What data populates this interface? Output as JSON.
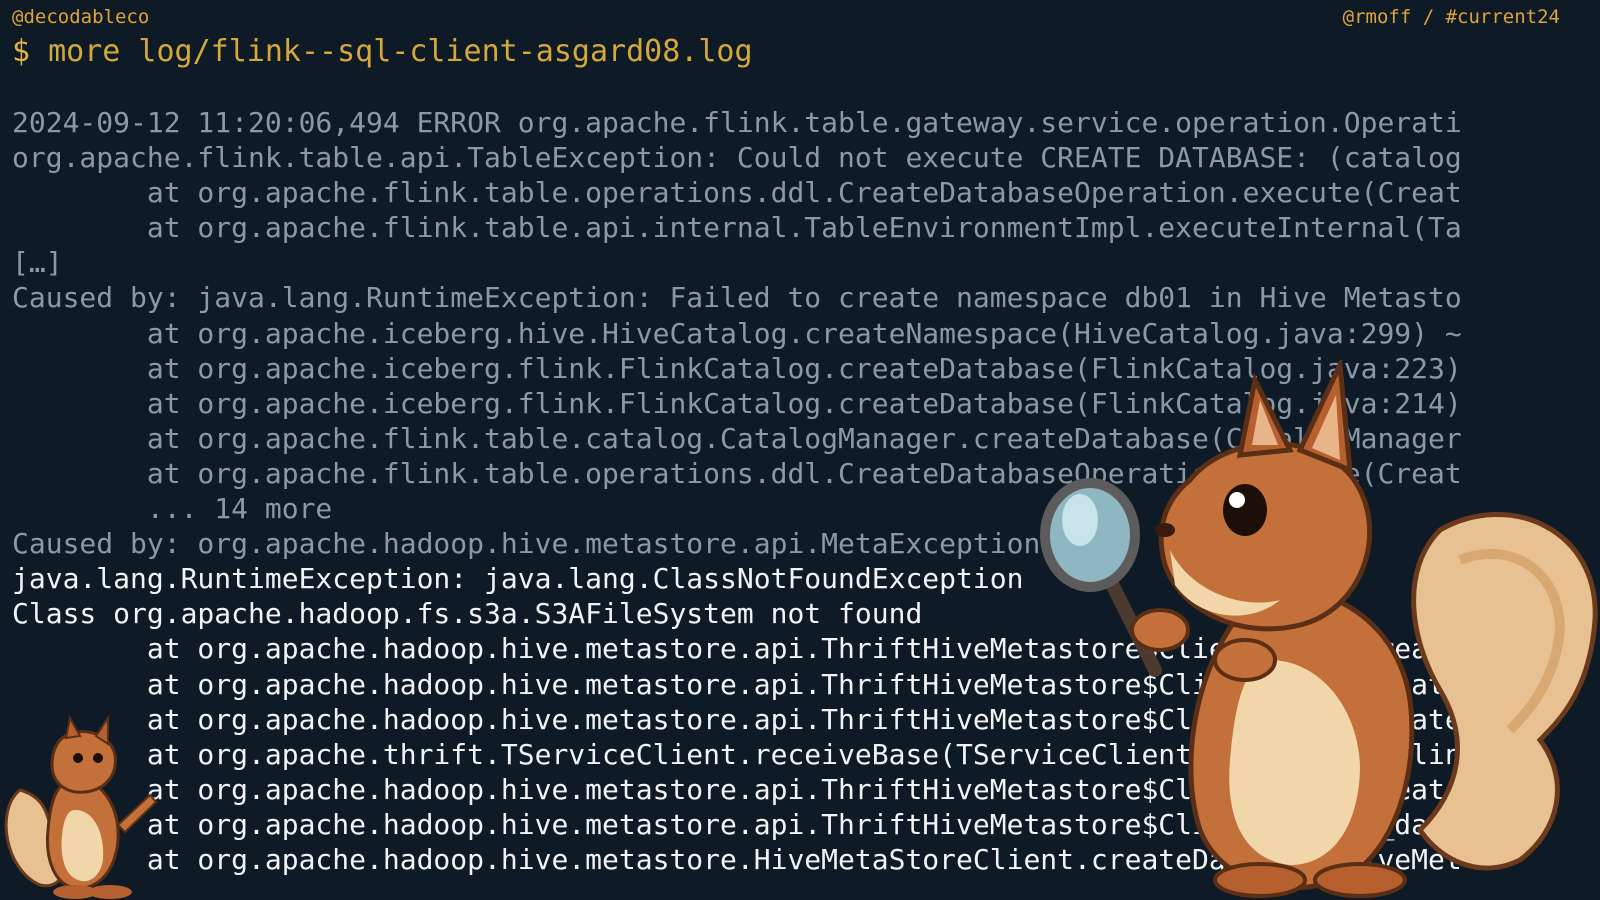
{
  "header": {
    "left_handle": "@decodableco",
    "right_handle": "@rmoff / #current24"
  },
  "terminal": {
    "prompt_symbol": "$",
    "command": "more log/flink--sql-client-asgard08.log"
  },
  "log": {
    "lines": [
      {
        "text": "2024-09-12 11:20:06,494 ERROR org.apache.flink.table.gateway.service.operation.Operati",
        "bright": false
      },
      {
        "text": "org.apache.flink.table.api.TableException: Could not execute CREATE DATABASE: (catalog",
        "bright": false
      },
      {
        "text": "        at org.apache.flink.table.operations.ddl.CreateDatabaseOperation.execute(Creat",
        "bright": false
      },
      {
        "text": "        at org.apache.flink.table.api.internal.TableEnvironmentImpl.executeInternal(Ta",
        "bright": false
      },
      {
        "text": "[…]",
        "bright": false
      },
      {
        "text": "Caused by: java.lang.RuntimeException: Failed to create namespace db01 in Hive Metasto",
        "bright": false
      },
      {
        "text": "        at org.apache.iceberg.hive.HiveCatalog.createNamespace(HiveCatalog.java:299) ~",
        "bright": false
      },
      {
        "text": "        at org.apache.iceberg.flink.FlinkCatalog.createDatabase(FlinkCatalog.java:223)",
        "bright": false
      },
      {
        "text": "        at org.apache.iceberg.flink.FlinkCatalog.createDatabase(FlinkCatalog.java:214)",
        "bright": false
      },
      {
        "text": "        at org.apache.flink.table.catalog.CatalogManager.createDatabase(CatalogManager",
        "bright": false
      },
      {
        "text": "        at org.apache.flink.table.operations.ddl.CreateDatabaseOperation.execute(Creat",
        "bright": false
      },
      {
        "text": "        ... 14 more",
        "bright": false
      },
      {
        "text": "Caused by: org.apache.hadoop.hive.metastore.api.MetaException",
        "bright": false
      },
      {
        "text": "java.lang.RuntimeException: java.lang.ClassNotFoundException",
        "bright": true
      },
      {
        "text": "Class org.apache.hadoop.fs.s3a.S3AFileSystem not found",
        "bright": true
      },
      {
        "text": "        at org.apache.hadoop.hive.metastore.api.ThriftHiveMetastore$Client.recv_create",
        "bright": true
      },
      {
        "text": "        at org.apache.hadoop.hive.metastore.api.ThriftHiveMetastore$Client.recv_create",
        "bright": true
      },
      {
        "text": "        at org.apache.hadoop.hive.metastore.api.ThriftHiveMetastore$Client.recv_create",
        "bright": true
      },
      {
        "text": "        at org.apache.thrift.TServiceClient.receiveBase(TServiceClient.java:88) ~[flin",
        "bright": true
      },
      {
        "text": "        at org.apache.hadoop.hive.metastore.api.ThriftHiveMetastore$Client.recv_create",
        "bright": true
      },
      {
        "text": "        at org.apache.hadoop.hive.metastore.api.ThriftHiveMetastore$Client.create_data",
        "bright": true
      },
      {
        "text": "        at org.apache.hadoop.hive.metastore.HiveMetaStoreClient.createDatabase(HiveMet",
        "bright": true
      }
    ]
  },
  "art": {
    "big_mascot_icon": "squirrel-with-magnifying-glass-icon",
    "small_mascot_icon": "squirrel-pointing-icon",
    "fur_color": "#c4703a",
    "belly_color": "#f0d6a8"
  }
}
